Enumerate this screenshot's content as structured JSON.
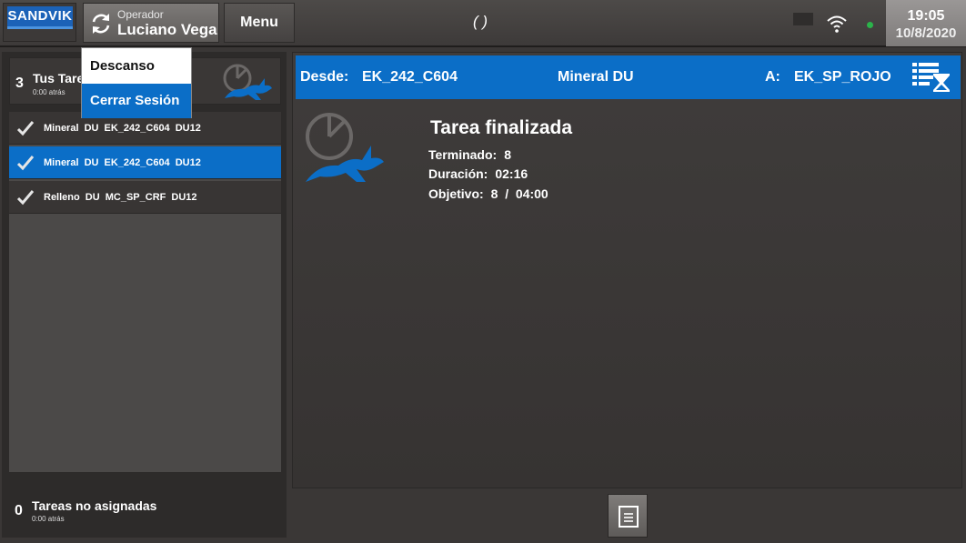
{
  "header": {
    "logo_text": "SANDVIK",
    "operator_label": "Operador",
    "operator_name": "Luciano Vega",
    "menu_label": "Menu",
    "center_text": "( )",
    "time": "19:05",
    "date": "10/8/2020"
  },
  "dropdown": {
    "items": [
      {
        "label": "Descanso"
      },
      {
        "label": "Cerrar Sesión"
      }
    ]
  },
  "tasks": {
    "count": "3",
    "title": "Tus Tare",
    "subtitle": "0:00 atrás",
    "items": [
      {
        "text": "Mineral DU  EK_242_C604  DU12",
        "selected": false
      },
      {
        "text": "Mineral DU  EK_242_C604  DU12",
        "selected": true
      },
      {
        "text": "Relleno DU  MC_SP_CRF  DU12",
        "selected": false
      }
    ]
  },
  "unassigned": {
    "count": "0",
    "title": "Tareas no asignadas",
    "subtitle": "0:00 atrás"
  },
  "route": {
    "from_label": "Desde:",
    "from": "EK_242_C604",
    "material": "Mineral DU",
    "to_label": "A:",
    "to": "EK_SP_ROJO"
  },
  "task_detail": {
    "title": "Tarea finalizada",
    "finished_label": "Terminado:",
    "finished_value": "8",
    "duration_label": "Duración:",
    "duration_value": "02:16",
    "goal_label": "Objetivo:",
    "goal_value": "8  /  04:00"
  },
  "colors": {
    "accent": "#0b6ec7",
    "background": "#3a3736",
    "status_dot": "#2bb34a"
  },
  "icons": [
    "refresh-icon",
    "wifi-icon",
    "status-dot-icon",
    "rabbit-speed-icon",
    "check-icon",
    "task-queue-icon",
    "document-icon"
  ]
}
